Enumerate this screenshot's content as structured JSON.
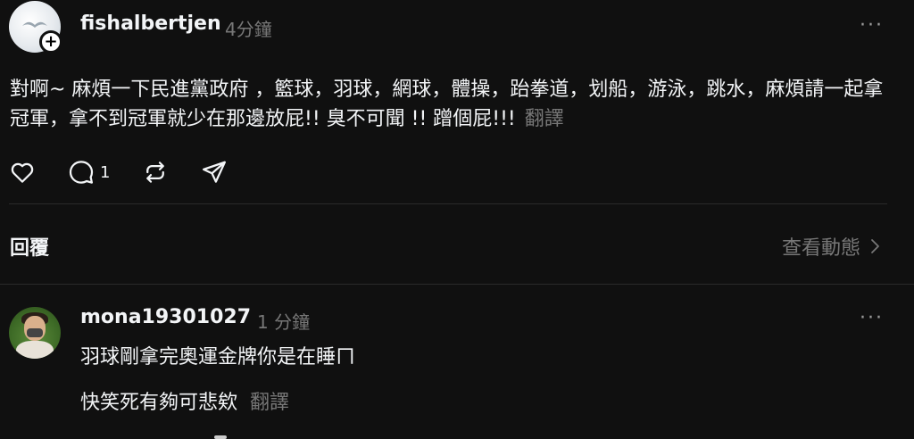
{
  "post": {
    "username": "fishalbertjen",
    "time": "4分鐘",
    "more": "···",
    "follow": "+",
    "text": "對啊~ 麻煩一下民進黨政府 ，籃球，羽球，網球，體操，跆拳道，划船，游泳，跳水，麻煩請一起拿冠軍，拿不到冠軍就少在那邊放屁!! 臭不可聞 !! 蹭個屁!!!",
    "translate": "翻譯",
    "reply_count": "1"
  },
  "replies_section": {
    "title": "回覆",
    "view_activity": "查看動態"
  },
  "reply": {
    "username": "mona19301027",
    "time": "1 分鐘",
    "more": "···",
    "line1": "羽球剛拿完奧運金牌你是在睡ㄇ",
    "line2": "快笑死有夠可悲欸",
    "translate": "翻譯"
  },
  "colors": {
    "background": "#101010",
    "text": "#f3f5f7",
    "muted": "#777777"
  },
  "icons": [
    "heart-icon",
    "comment-icon",
    "repost-icon",
    "share-icon",
    "chevron-right-icon"
  ]
}
